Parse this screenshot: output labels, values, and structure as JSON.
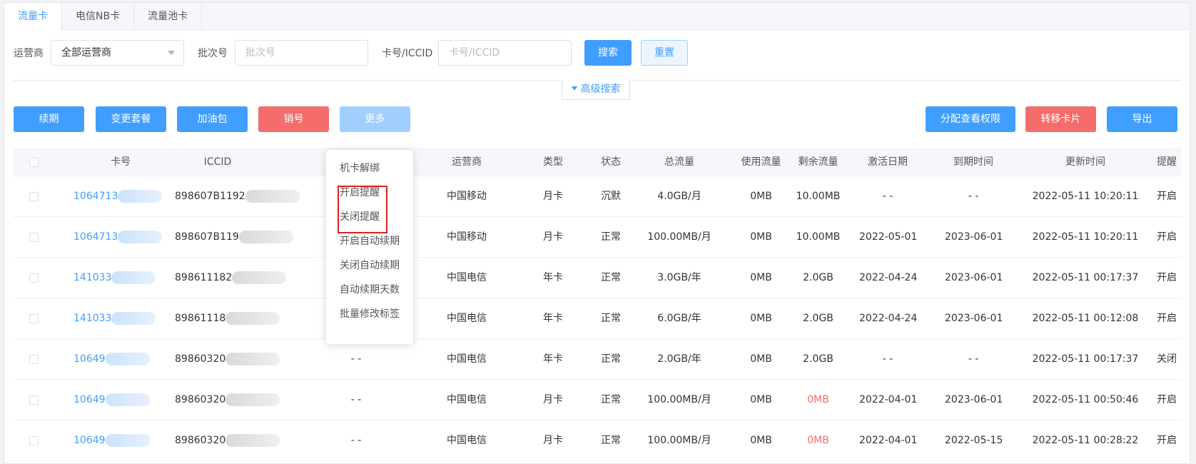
{
  "tabs": [
    {
      "label": "流量卡",
      "active": true
    },
    {
      "label": "电信NB卡",
      "active": false
    },
    {
      "label": "流量池卡",
      "active": false
    }
  ],
  "filters": {
    "operator_label": "运营商",
    "operator_value": "全部运营商",
    "batch_label": "批次号",
    "batch_placeholder": "批次号",
    "card_label": "卡号/ICCID",
    "card_placeholder": "卡号/ICCID",
    "search_label": "搜索",
    "reset_label": "重置",
    "advanced_label": "高级搜索"
  },
  "toolbar": {
    "renew": "续期",
    "change_plan": "变更套餐",
    "addon": "加油包",
    "cancel": "销号",
    "more": "更多",
    "assign_permission": "分配查看权限",
    "transfer": "转移卡片",
    "export": "导出"
  },
  "more_menu": [
    "机卡解绑",
    "开启提醒",
    "关闭提醒",
    "开启自动续期",
    "关闭自动续期",
    "自动续期天数",
    "批量修改标签"
  ],
  "table": {
    "headers": [
      "卡号",
      "ICCID",
      "运营商",
      "类型",
      "状态",
      "总流量",
      "使用流量",
      "剩余流量",
      "激活日期",
      "到期时间",
      "更新时间",
      "提醒"
    ],
    "rows": [
      {
        "card": "1064713",
        "iccid": "898607B1192",
        "tag": "",
        "operator": "中国移动",
        "type": "月卡",
        "status": "沉默",
        "total": "4.0GB/月",
        "used": "0MB",
        "remain": "10.00MB",
        "remain_red": false,
        "activated": "- -",
        "expire": "- -",
        "updated": "2022-05-11 10:20:11",
        "remind": "开启"
      },
      {
        "card": "1064713",
        "iccid": "898607B119",
        "tag": "",
        "operator": "中国移动",
        "type": "月卡",
        "status": "正常",
        "total": "100.00MB/月",
        "used": "0MB",
        "remain": "10.00MB",
        "remain_red": false,
        "activated": "2022-05-01",
        "expire": "2023-06-01",
        "updated": "2022-05-11 10:20:11",
        "remind": "开启"
      },
      {
        "card": "141033",
        "iccid": "898611182",
        "tag": "",
        "operator": "中国电信",
        "type": "年卡",
        "status": "正常",
        "total": "3.0GB/年",
        "used": "0MB",
        "remain": "2.0GB",
        "remain_red": false,
        "activated": "2022-04-24",
        "expire": "2023-06-01",
        "updated": "2022-05-11 00:17:37",
        "remind": "开启"
      },
      {
        "card": "141033",
        "iccid": "89861118",
        "tag": "",
        "operator": "中国电信",
        "type": "年卡",
        "status": "正常",
        "total": "6.0GB/年",
        "used": "0MB",
        "remain": "2.0GB",
        "remain_red": false,
        "activated": "2022-04-24",
        "expire": "2023-06-01",
        "updated": "2022-05-11 00:12:08",
        "remind": "开启"
      },
      {
        "card": "10649",
        "iccid": "89860320",
        "tag": "- -",
        "operator": "中国电信",
        "type": "年卡",
        "status": "正常",
        "total": "2.0GB/年",
        "used": "0MB",
        "remain": "2.0GB",
        "remain_red": false,
        "activated": "- -",
        "expire": "- -",
        "updated": "2022-05-11 00:17:37",
        "remind": "关闭"
      },
      {
        "card": "10649",
        "iccid": "89860320",
        "tag": "- -",
        "operator": "中国电信",
        "type": "月卡",
        "status": "正常",
        "total": "100.00MB/月",
        "used": "0MB",
        "remain": "0MB",
        "remain_red": true,
        "activated": "2022-04-01",
        "expire": "2023-06-01",
        "updated": "2022-05-11 00:50:46",
        "remind": "开启"
      },
      {
        "card": "10649",
        "iccid": "89860320",
        "tag": "- -",
        "operator": "中国电信",
        "type": "月卡",
        "status": "正常",
        "total": "100.00MB/月",
        "used": "0MB",
        "remain": "0MB",
        "remain_red": true,
        "activated": "2022-04-01",
        "expire": "2022-05-15",
        "updated": "2022-05-11 00:28:22",
        "remind": "开启"
      }
    ]
  },
  "colors": {
    "primary": "#409eff",
    "danger": "#f56c6c",
    "highlight": "#e02020"
  }
}
